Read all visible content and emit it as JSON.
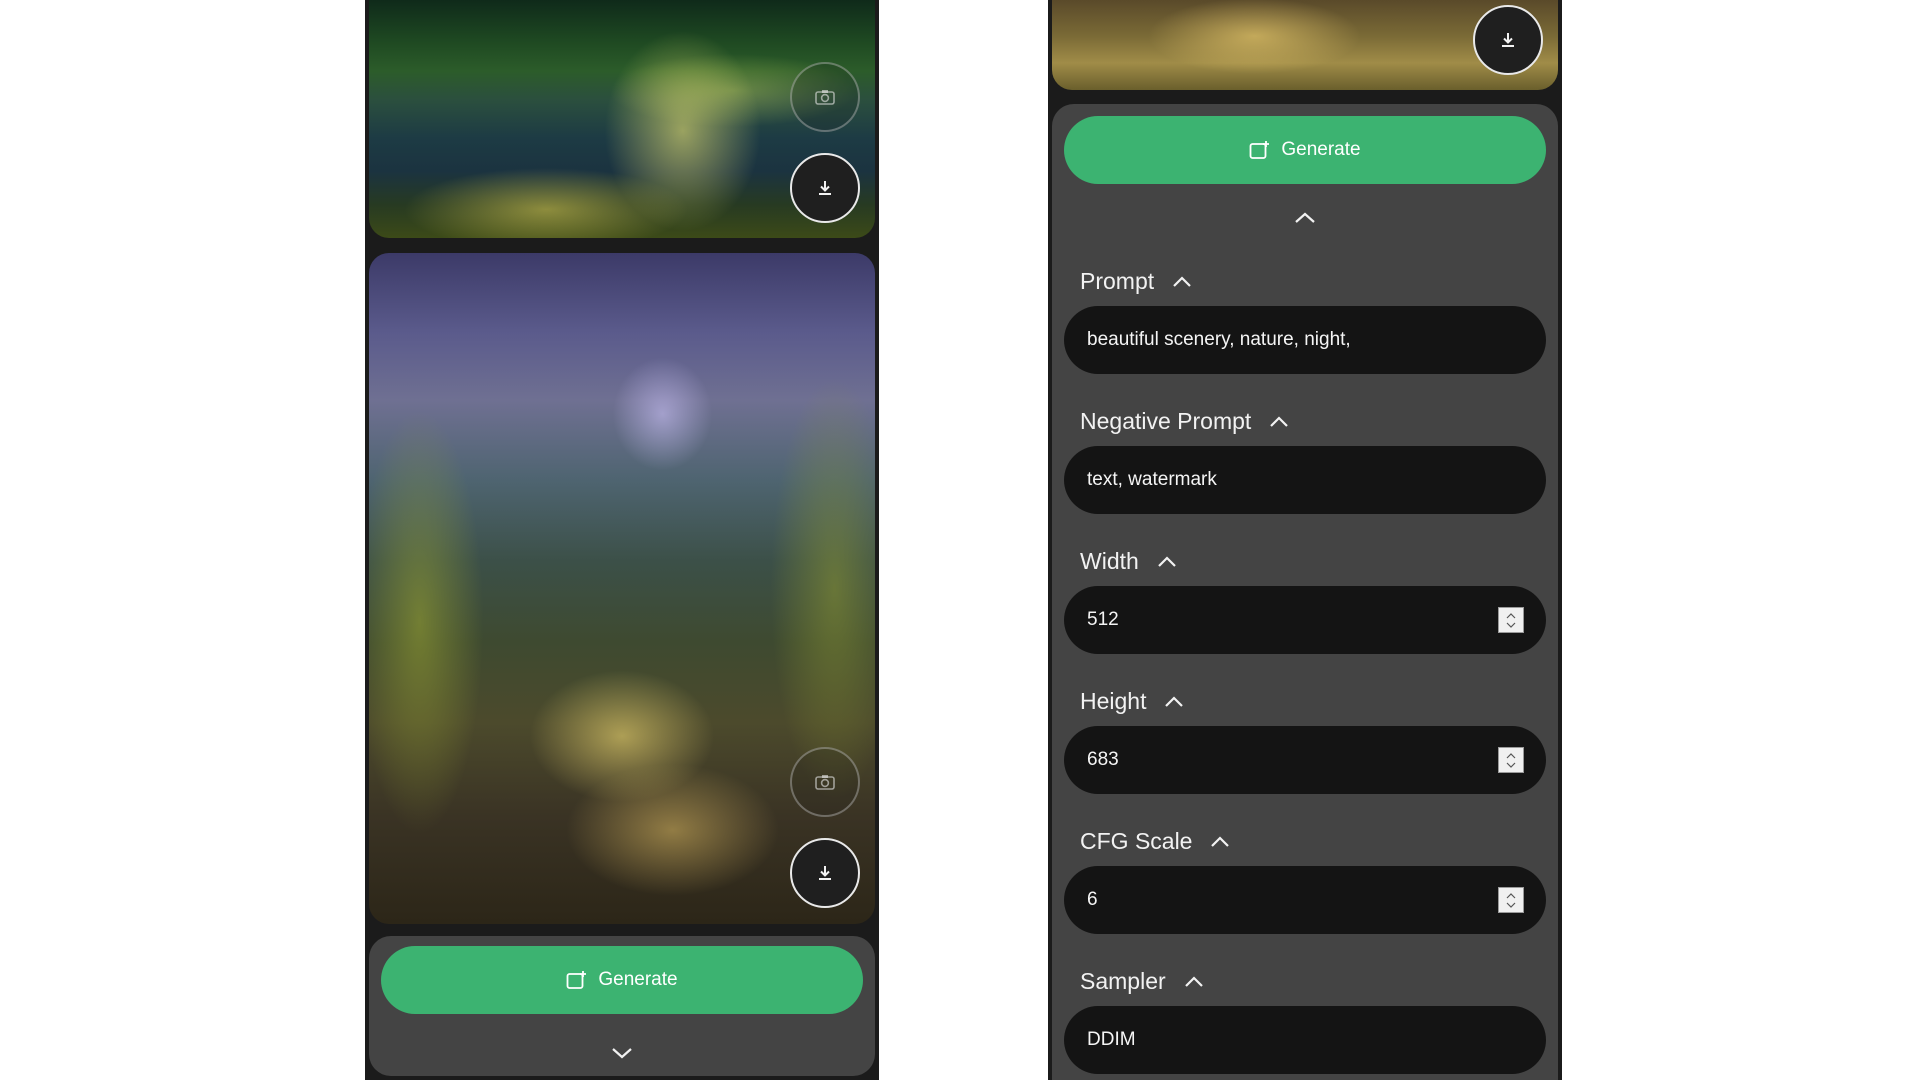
{
  "left_panel": {
    "images": [
      {
        "icons": [
          "camera-icon",
          "download-icon"
        ]
      },
      {
        "icons": [
          "camera-icon",
          "download-icon"
        ]
      }
    ],
    "generate_label": "Generate",
    "toggle_icon": "chevron-down-icon"
  },
  "right_panel": {
    "images": [
      {
        "icons": [
          "download-icon"
        ]
      }
    ],
    "generate_label": "Generate",
    "toggle_icon": "chevron-up-icon",
    "fields": {
      "prompt": {
        "label": "Prompt",
        "value": "beautiful scenery, nature, night,"
      },
      "negative_prompt": {
        "label": "Negative Prompt",
        "value": "text, watermark"
      },
      "width": {
        "label": "Width",
        "value": "512"
      },
      "height": {
        "label": "Height",
        "value": "683"
      },
      "cfg_scale": {
        "label": "CFG Scale",
        "value": "6"
      },
      "sampler": {
        "label": "Sampler",
        "value": "DDIM"
      }
    }
  },
  "colors": {
    "generate_button": "#3cb371",
    "panel_background": "#444444",
    "field_background": "#141414",
    "phone_background": "#1b1b1b"
  }
}
